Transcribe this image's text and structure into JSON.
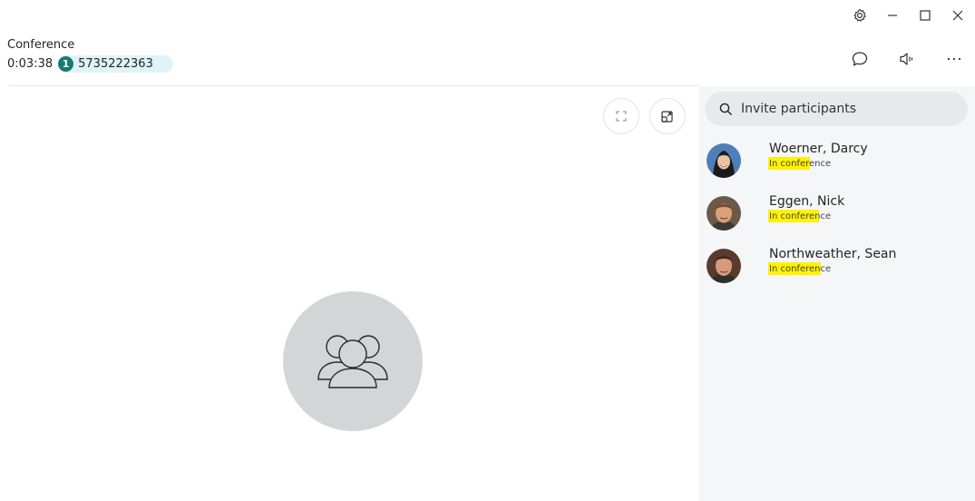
{
  "header": {
    "title": "Conference",
    "duration": "0:03:38",
    "participant_count": "1",
    "conference_number": "5735222363"
  },
  "search": {
    "placeholder": "Invite participants"
  },
  "participants": [
    {
      "name": "Woerner, Darcy",
      "status": "In conference"
    },
    {
      "name": "Eggen, Nick",
      "status": "In conference"
    },
    {
      "name": "Northweather, Sean",
      "status": "In conference"
    }
  ],
  "colors": {
    "badge": "#197b6e",
    "pill": "#dff3f9",
    "highlight": "#fff200",
    "panel": "#f5f6f7",
    "group_avatar": "#d3d5d6"
  },
  "icons": {
    "settings": "gear-icon",
    "minimize": "minimize-icon",
    "maximize": "maximize-icon",
    "close": "close-icon",
    "chat": "chat-icon",
    "speaker": "speaker-icon",
    "more": "more-icon",
    "fullscreen": "fullscreen-icon",
    "popout": "popout-icon",
    "search": "search-icon",
    "group": "group-icon"
  }
}
